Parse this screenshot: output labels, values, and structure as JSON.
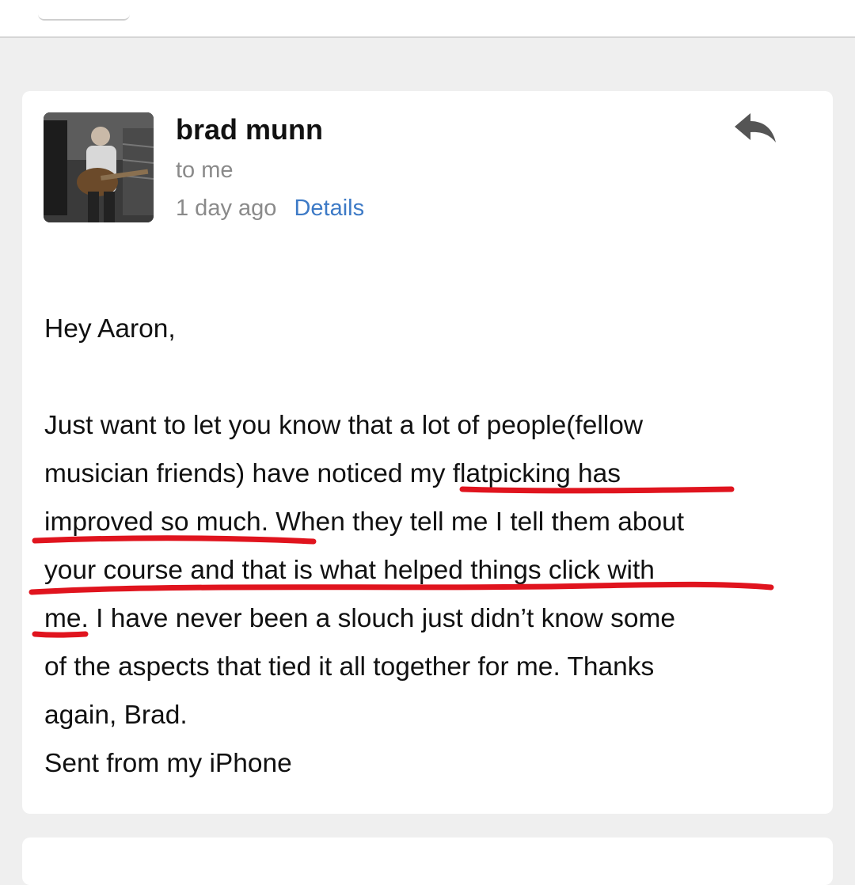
{
  "email": {
    "sender_name": "brad munn",
    "recipient": "to me",
    "time": "1 day ago",
    "details_link": "Details",
    "greeting": "Hey Aaron,",
    "body_lines": [
      "Just want to let you know that a lot of people(fellow",
      "musician friends) have noticed my flatpicking has",
      "improved so much. When they tell me I tell them about",
      "your course and that is what helped things click with",
      "me. I have never been a slouch just didn’t know some",
      "of the aspects that tied it all together for me. Thanks",
      "again, Brad.",
      "Sent from my iPhone"
    ]
  },
  "icons": {
    "reply": "reply-arrow-icon",
    "avatar": "sender-photo"
  },
  "colors": {
    "link": "#3d7ac6",
    "annotation": "#e0141e",
    "muted_text": "#8a8a8a"
  }
}
